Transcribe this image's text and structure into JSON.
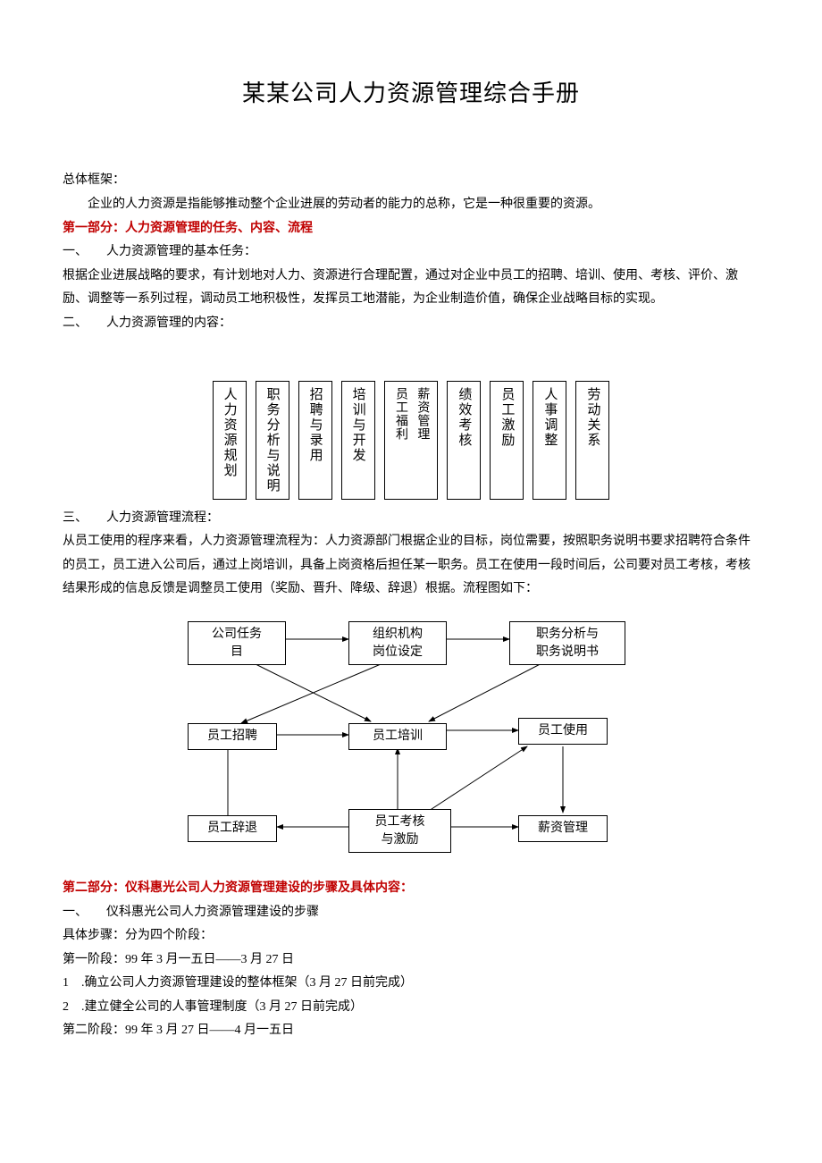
{
  "title": "某某公司人力资源管理综合手册",
  "intro_label": "总体框架：",
  "intro_body": "企业的人力资源是指能够推动整个企业进展的劳动者的能力的总称，它是一种很重要的资源。",
  "part1_heading": "第一部分：人力资源管理的任务、内容、流程",
  "sec1_label": "一、　　人力资源管理的基本任务：",
  "sec1_body": "根据企业进展战略的要求，有计划地对人力、资源进行合理配置，通过对企业中员工的招聘、培训、使用、考核、评价、激励、调整等一系列过程，调动员工地积极性，发挥员工地潜能，为企业制造价值，确保企业战略目标的实现。",
  "sec2_label": "二、　　人力资源管理的内容：",
  "boxes": [
    "人力资源规划",
    "职务分析与说明",
    "招聘与录用",
    "培训与开发",
    "员工福利|薪资管理",
    "绩效考核",
    "员工激励",
    "人事调整",
    "劳动关系"
  ],
  "sec3_label": "三、　　人力资源管理流程：",
  "sec3_body": "从员工使用的程序来看，人力资源管理流程为：人力资源部门根据企业的目标，岗位需要，按照职务说明书要求招聘符合条件的员工，员工进入公司后，通过上岗培训，具备上岗资格后担任某一职务。员工在使用一段时间后，公司要对员工考核，考核结果形成的信息反馈是调整员工使用（奖励、晋升、降级、辞退）根据。流程图如下：",
  "flow": {
    "n1": "公司任务\n目",
    "n2": "组织机构\n岗位设定",
    "n3": "职务分析与\n职务说明书",
    "n4": "员工招聘",
    "n5": "员工培训",
    "n6": "员工使用",
    "n7": "员工辞退",
    "n8": "员工考核\n与激励",
    "n9": "薪资管理"
  },
  "part2_heading": "第二部分：仪科惠光公司人力资源管理建设的步骤及具体内容：",
  "p2_sec1_label": "一、　　仪科惠光公司人力资源管理建设的步骤",
  "p2_steps_label": "具体步骤：分为四个阶段：",
  "p2_stage1": "第一阶段：99 年 3 月一五日——3 月 27 日",
  "p2_item1": "1　.确立公司人力资源管理建设的整体框架（3 月 27 日前完成）",
  "p2_item2": "2　.建立健全公司的人事管理制度（3 月 27 日前完成）",
  "p2_stage2": "第二阶段：99 年 3 月 27 日——4 月一五日"
}
